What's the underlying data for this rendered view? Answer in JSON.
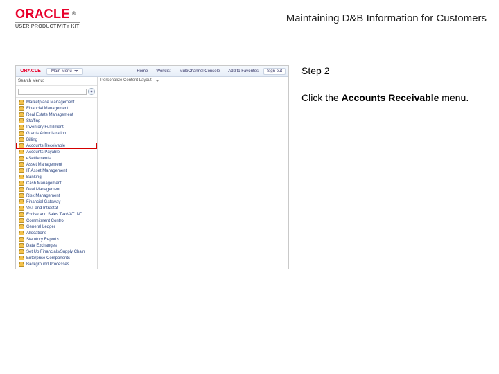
{
  "header": {
    "brand": "ORACLE",
    "brand_sub": "USER PRODUCTIVITY KIT",
    "doc_title": "Maintaining D&B Information for Customers"
  },
  "instruction": {
    "step_label": "Step 2",
    "text_before": "Click the ",
    "bold": "Accounts Receivable",
    "text_after": " menu."
  },
  "shot": {
    "crumb": "Main Menu",
    "nav": [
      "Home",
      "Worklist",
      "MultiChannel Console",
      "Add to Favorites",
      "Sign out"
    ],
    "search_label": "Search Menu:",
    "content_bar": "Personalize Content  Layout",
    "menu_items": [
      "Marketplace Management",
      "Financial Management",
      "Real Estate Management",
      "Staffing",
      "Inventory Fulfillment",
      "Grants Administration",
      "Billing",
      "Accounts Receivable",
      "Accounts Payable",
      "eSettlements",
      "Asset Management",
      "IT Asset Management",
      "Banking",
      "Cash Management",
      "Deal Management",
      "Risk Management",
      "Financial Gateway",
      "VAT and Intrastat",
      "Excise and Sales Tax/VAT IND",
      "Commitment Control",
      "General Ledger",
      "Allocations",
      "Statutory Reports",
      "Data Exchanges",
      "Set Up Financials/Supply Chain",
      "Enterprise Components",
      "Background Processes"
    ],
    "highlight_index": 7
  }
}
